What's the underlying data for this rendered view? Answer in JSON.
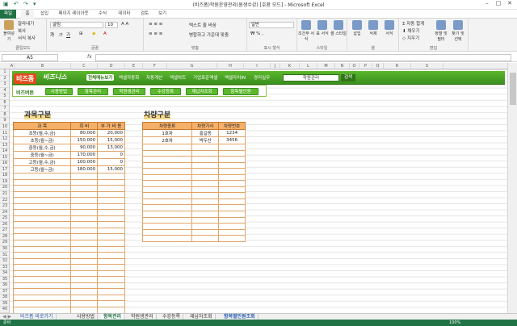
{
  "window": {
    "title": "(비즈폼)학원운영관리(원생수강) [호환 모드] - Microsoft Excel"
  },
  "ribbon_tabs": [
    "파일",
    "홈",
    "삽입",
    "페이지 레이아웃",
    "수식",
    "데이터",
    "검토",
    "보기"
  ],
  "ribbon": {
    "clipboard": {
      "paste": "붙여넣기",
      "cut": "잘라내기",
      "copy": "복사",
      "format_painter": "서식 복사",
      "label": "클립보드"
    },
    "font": {
      "name": "굴림",
      "size": "10",
      "label": "글꼴"
    },
    "align": {
      "wrap": "텍스트 줄 바꿈",
      "merge": "병합하고 가운데 맞춤",
      "label": "맞춤"
    },
    "number": {
      "format": "일반",
      "label": "표시 형식"
    },
    "styles": {
      "cond": "조건부 서식",
      "table": "표 서식",
      "cell": "셀 스타일",
      "label": "스타일"
    },
    "cells": {
      "insert": "삽입",
      "delete": "삭제",
      "format": "서식",
      "label": "셀"
    },
    "editing": {
      "autosum": "자동 합계",
      "fill": "채우기",
      "clear": "지우기",
      "sort": "정렬 및 필터",
      "find": "찾기 및 선택",
      "label": "편집"
    }
  },
  "formula_bar": {
    "cell_ref": "A5",
    "fx": "fx",
    "value": ""
  },
  "columns": [
    "A",
    "B",
    "C",
    "D",
    "E",
    "F",
    "G",
    "H",
    "I",
    "J",
    "K",
    "L",
    "M",
    "N",
    "O",
    "P",
    "Q",
    "R",
    "S"
  ],
  "navbar": {
    "logo1": "비즈폼",
    "logo2": "비즈니스",
    "items": [
      "전체메뉴보기",
      "엑셀자동화",
      "자동계산",
      "엑셀차트",
      "기업표준엑셀",
      "엑셀자치IN",
      "경리실무"
    ],
    "search_value": "학원관리",
    "search_button": "검색"
  },
  "subbar": {
    "label": "비즈버튼",
    "buttons": [
      "사용방법",
      "항목관리",
      "학원생관리",
      "수강등록",
      "재납자조회",
      "항목별인원"
    ]
  },
  "section1": {
    "title": "과목구분",
    "headers": [
      "과   목",
      "회   비",
      "부 가 비 용"
    ],
    "rows": [
      [
        "초등(월,수,금)",
        "80,000",
        "20,000"
      ],
      [
        "초등(월~금)",
        "150,000",
        "15,000"
      ],
      [
        "중등(월,수,금)",
        "90,000",
        "13,000"
      ],
      [
        "중등(월~금)",
        "170,000",
        "0"
      ],
      [
        "고등(월,수,금)",
        "100,000",
        "0"
      ],
      [
        "고등(월~금)",
        "180,000",
        "15,000"
      ]
    ]
  },
  "section2": {
    "title": "차량구분",
    "headers": [
      "차량종류",
      "차량기사",
      "차량번호"
    ],
    "rows": [
      [
        "1호차",
        "홍길동",
        "1234"
      ],
      [
        "2호차",
        "박두산",
        "3456"
      ]
    ]
  },
  "sheet_tabs": [
    "비즈폼 바로가기",
    "사용방법",
    "항목관리",
    "학원생관리",
    "수강등록",
    "재납자조회",
    "항목별인원조회"
  ],
  "active_sheet": "항목관리",
  "status": {
    "state": "준비",
    "zoom": "100%"
  }
}
